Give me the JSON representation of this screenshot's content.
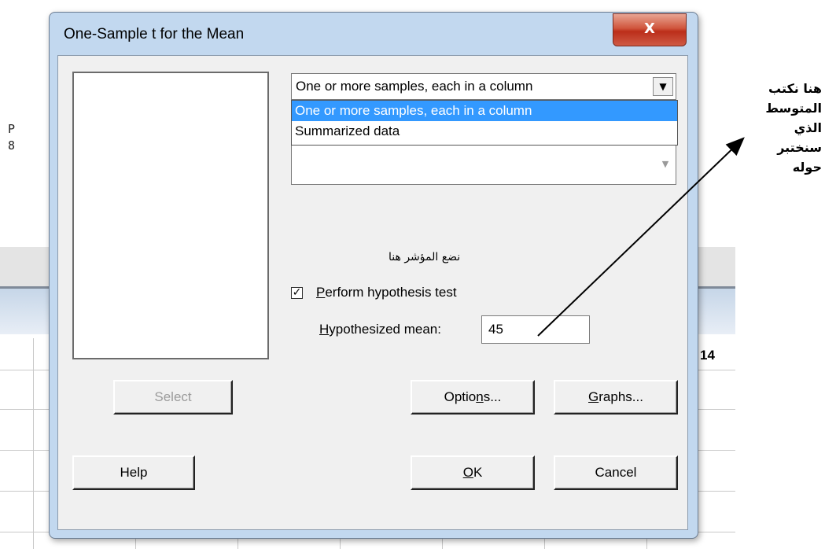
{
  "background": {
    "side_letters": [
      "P",
      "8"
    ],
    "column_number": "14"
  },
  "dialog": {
    "title": "One-Sample t for the Mean",
    "close_glyph": "X",
    "combo": {
      "selected": "One or more samples, each in a column",
      "options": [
        "One or more samples, each in a column",
        "Summarized data"
      ],
      "highlighted_index": 0
    },
    "cursor_note": "نضع المؤشر هنا",
    "hypothesis": {
      "checkbox_checked": true,
      "check_mark": "✓",
      "checkbox_label_first": "P",
      "checkbox_label_rest": "erform hypothesis test",
      "mean_label_first": "H",
      "mean_label_rest": "ypothesized mean:",
      "mean_value": "45"
    },
    "buttons": {
      "select": "Select",
      "options_pre": "Optio",
      "options_u": "n",
      "options_post": "s...",
      "graphs_u": "G",
      "graphs_post": "raphs...",
      "help": "Help",
      "ok_u": "O",
      "ok_post": "K",
      "cancel": "Cancel"
    }
  },
  "annotation": {
    "lines": [
      "هنا نكتب",
      "المتوسط",
      "الذي",
      "سنختبر",
      "حوله"
    ]
  }
}
